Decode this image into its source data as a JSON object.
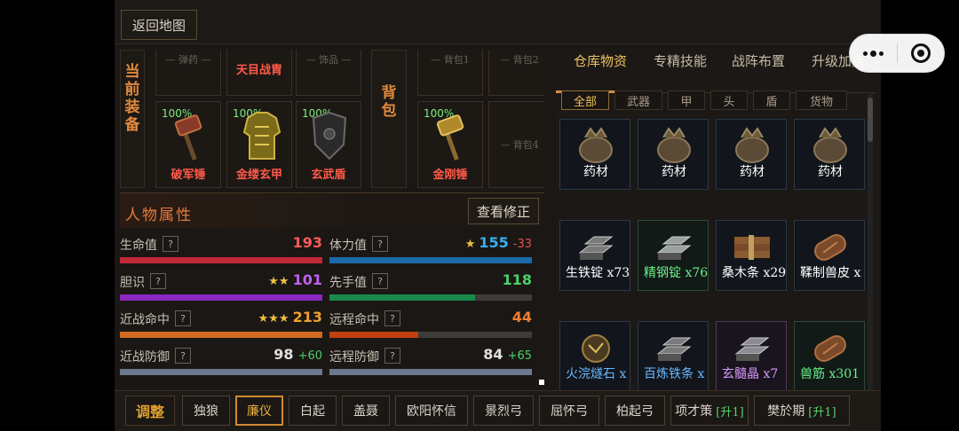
{
  "topbar": {
    "back_label": "返回地图"
  },
  "equipment": {
    "label": "当前装备",
    "top_row": [
      {
        "name": "弹药",
        "empty": true
      },
      {
        "name": "天目战胄",
        "empty": false
      },
      {
        "name": "饰品",
        "empty": true
      }
    ],
    "items": [
      {
        "name": "破军锤",
        "durability": "100%",
        "icon": "hammer-icon"
      },
      {
        "name": "金缕玄甲",
        "durability": "100%",
        "icon": "armor-icon"
      },
      {
        "name": "玄武盾",
        "durability": "100%",
        "icon": "shield-icon"
      }
    ]
  },
  "bag": {
    "label": "背包",
    "top_row": [
      "背包1",
      "背包2"
    ],
    "items": [
      {
        "name": "金刚锤",
        "durability": "100%",
        "icon": "hammer-icon"
      },
      {
        "name": "背包4",
        "empty": true
      }
    ]
  },
  "attributes": {
    "title": "人物属性",
    "view_button": "查看修正",
    "help_glyph": "?",
    "stats": [
      {
        "label": "生命值",
        "stars": "",
        "value": "193",
        "mod": "",
        "color": "#ff5a5a",
        "bar_color": "#c0283a",
        "fill": 1.0
      },
      {
        "label": "体力值",
        "stars": "★",
        "value": "155",
        "mod": "-33",
        "color": "#38b0f0",
        "mod_color": "#e05050",
        "bar_color": "#1a6aaa",
        "fill": 1.0
      },
      {
        "label": "胆识",
        "stars": "★★",
        "value": "101",
        "mod": "",
        "color": "#c060f0",
        "bar_color": "#8a28c0",
        "fill": 1.0
      },
      {
        "label": "先手值",
        "stars": "",
        "value": "118",
        "mod": "",
        "color": "#4ad06a",
        "bar_color": "#1a8a4a",
        "fill": 0.72
      },
      {
        "label": "近战命中",
        "stars": "★★★",
        "value": "213",
        "mod": "",
        "color": "#f0a030",
        "bar_color": "#d06a20",
        "fill": 1.0
      },
      {
        "label": "远程命中",
        "stars": "",
        "value": "44",
        "mod": "",
        "color": "#f08030",
        "bar_color": "#c04010",
        "fill": 0.44
      },
      {
        "label": "近战防御",
        "stars": "",
        "value": "98",
        "mod": "+60",
        "color": "#e0e0e0",
        "mod_color": "#4ad06a",
        "bar_color": "#6a7890",
        "fill": 1.0
      },
      {
        "label": "远程防御",
        "stars": "",
        "value": "84",
        "mod": "+65",
        "color": "#e0e0e0",
        "mod_color": "#4ad06a",
        "bar_color": "#6a7890",
        "fill": 1.0
      }
    ]
  },
  "tabs": [
    {
      "label": "仓库物资",
      "active": true
    },
    {
      "label": "专精技能",
      "active": false
    },
    {
      "label": "战阵布置",
      "active": false
    },
    {
      "label": "升级加点",
      "active": false
    }
  ],
  "filters": [
    "全部",
    "武器",
    "甲",
    "头",
    "盾",
    "货物"
  ],
  "inventory": [
    {
      "name": "药材",
      "icon": "herb-bag-icon",
      "tone": "blue",
      "name_color": "#ffffff"
    },
    {
      "name": "药材",
      "icon": "herb-bag-icon",
      "tone": "blue",
      "name_color": "#ffffff"
    },
    {
      "name": "药材",
      "icon": "herb-bag-icon",
      "tone": "blue",
      "name_color": "#ffffff"
    },
    {
      "name": "药材",
      "icon": "herb-bag-icon",
      "tone": "blue",
      "name_color": "#ffffff"
    },
    {
      "name": "生铁锭 x73",
      "icon": "iron-ingot-icon",
      "tone": "blue",
      "name_color": "#ffffff"
    },
    {
      "name": "精钢锭 x76",
      "icon": "steel-ingot-icon",
      "tone": "green",
      "name_color": "#6af08a"
    },
    {
      "name": "桑木条 x29",
      "icon": "wood-bundle-icon",
      "tone": "blue",
      "name_color": "#ffffff"
    },
    {
      "name": "鞣制兽皮 x",
      "icon": "leather-roll-icon",
      "tone": "blue",
      "name_color": "#ffffff"
    },
    {
      "name": "火浣燧石 x",
      "icon": "flint-icon",
      "tone": "blue",
      "name_color": "#6ab8ff"
    },
    {
      "name": "百炼铁条 x",
      "icon": "iron-bar-icon",
      "tone": "blue",
      "name_color": "#6ab8ff"
    },
    {
      "name": "玄髓晶 x7",
      "icon": "crystal-ingot-icon",
      "tone": "purple",
      "name_color": "#d89aff"
    },
    {
      "name": "兽筋 x301",
      "icon": "sinew-roll-icon",
      "tone": "green",
      "name_color": "#6af08a"
    }
  ],
  "bottom_bar": {
    "adjust_label": "调整",
    "generals": [
      {
        "name": "独狼",
        "selected": false,
        "upgrade": ""
      },
      {
        "name": "廉仪",
        "selected": true,
        "upgrade": ""
      },
      {
        "name": "白起",
        "selected": false,
        "upgrade": ""
      },
      {
        "name": "盖聂",
        "selected": false,
        "upgrade": ""
      },
      {
        "name": "欧阳怀信",
        "selected": false,
        "upgrade": ""
      },
      {
        "name": "景烈弓",
        "selected": false,
        "upgrade": ""
      },
      {
        "name": "屈怀弓",
        "selected": false,
        "upgrade": ""
      },
      {
        "name": "柏起弓",
        "selected": false,
        "upgrade": ""
      },
      {
        "name": "项才策",
        "selected": false,
        "upgrade": "[升1]"
      },
      {
        "name": "樊於期",
        "selected": false,
        "upgrade": "[升1]"
      }
    ]
  }
}
